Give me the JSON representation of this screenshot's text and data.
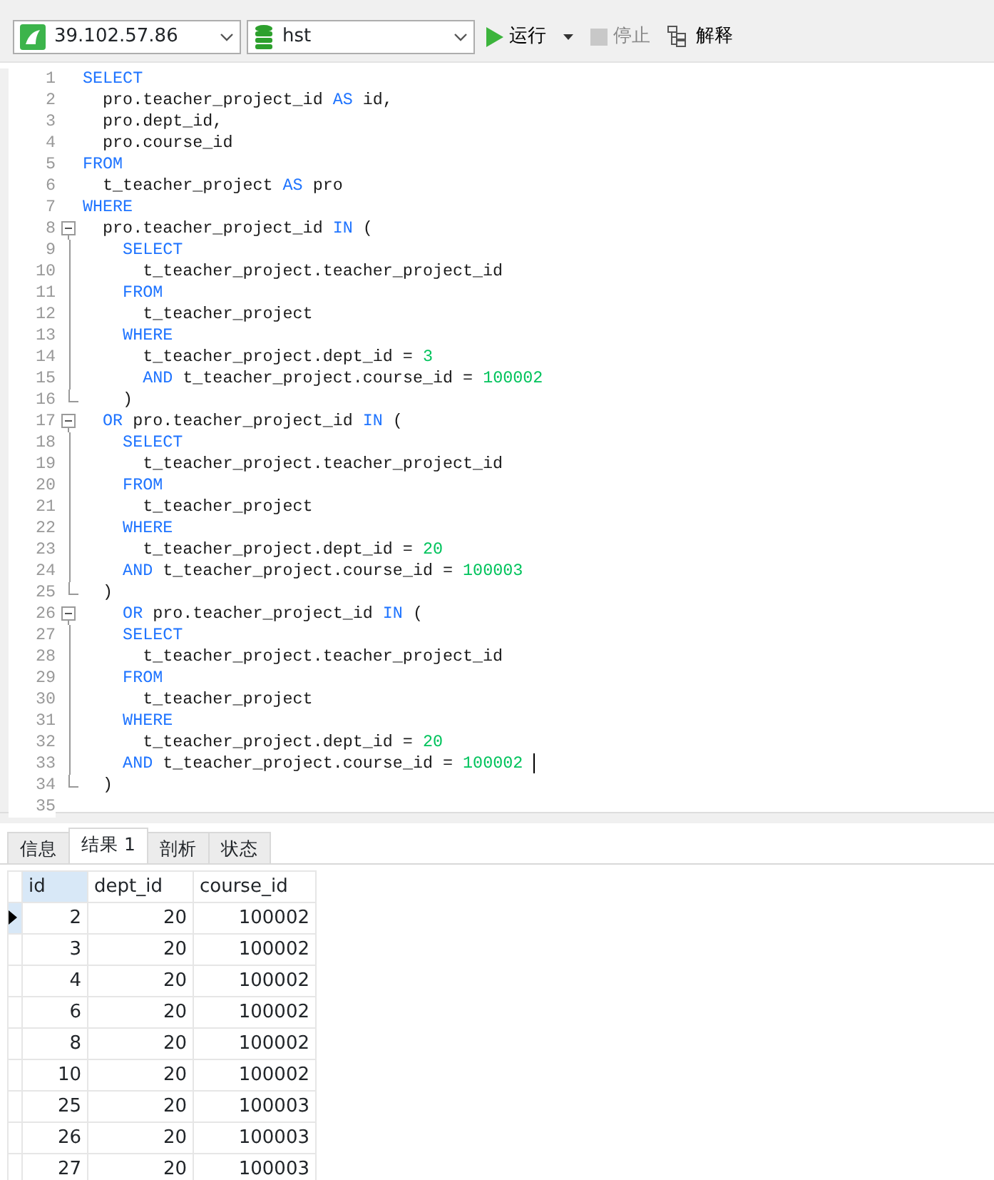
{
  "toolbar": {
    "connection": "39.102.57.86",
    "database": "hst",
    "run": "运行",
    "stop": "停止",
    "explain": "解释"
  },
  "editor": {
    "lines": [
      {
        "num": "1",
        "kind": "plain",
        "tokens": [
          {
            "kind": "keyword",
            "text": "SELECT"
          }
        ]
      },
      {
        "num": "2",
        "kind": "plain",
        "tokens": [
          {
            "kind": "plain",
            "text": "  pro.teacher_project_id "
          },
          {
            "kind": "keyword",
            "text": "AS"
          },
          {
            "kind": "plain",
            "text": " id,"
          }
        ]
      },
      {
        "num": "3",
        "kind": "plain",
        "tokens": [
          {
            "kind": "plain",
            "text": "  pro.dept_id,"
          }
        ]
      },
      {
        "num": "4",
        "kind": "plain",
        "tokens": [
          {
            "kind": "plain",
            "text": "  pro.course_id"
          }
        ]
      },
      {
        "num": "5",
        "kind": "plain",
        "tokens": [
          {
            "kind": "keyword",
            "text": "FROM"
          }
        ]
      },
      {
        "num": "6",
        "kind": "plain",
        "tokens": [
          {
            "kind": "plain",
            "text": "  t_teacher_project "
          },
          {
            "kind": "keyword",
            "text": "AS"
          },
          {
            "kind": "plain",
            "text": " pro"
          }
        ]
      },
      {
        "num": "7",
        "kind": "plain",
        "tokens": [
          {
            "kind": "keyword",
            "text": "WHERE"
          }
        ]
      },
      {
        "num": "8",
        "kind": "foldstart",
        "tokens": [
          {
            "kind": "plain",
            "text": "  pro.teacher_project_id "
          },
          {
            "kind": "keyword",
            "text": "IN"
          },
          {
            "kind": "plain",
            "text": " ("
          }
        ]
      },
      {
        "num": "9",
        "kind": "foldbody",
        "tokens": [
          {
            "kind": "keyword",
            "text": "    SELECT"
          }
        ]
      },
      {
        "num": "10",
        "kind": "foldbody",
        "tokens": [
          {
            "kind": "plain",
            "text": "      t_teacher_project.teacher_project_id"
          }
        ]
      },
      {
        "num": "11",
        "kind": "foldbody",
        "tokens": [
          {
            "kind": "keyword",
            "text": "    FROM"
          }
        ]
      },
      {
        "num": "12",
        "kind": "foldbody",
        "tokens": [
          {
            "kind": "plain",
            "text": "      t_teacher_project"
          }
        ]
      },
      {
        "num": "13",
        "kind": "foldbody",
        "tokens": [
          {
            "kind": "keyword",
            "text": "    WHERE"
          }
        ]
      },
      {
        "num": "14",
        "kind": "foldbody",
        "tokens": [
          {
            "kind": "plain",
            "text": "      t_teacher_project.dept_id = "
          },
          {
            "kind": "number",
            "text": "3"
          }
        ]
      },
      {
        "num": "15",
        "kind": "foldbody",
        "tokens": [
          {
            "kind": "keyword",
            "text": "      AND"
          },
          {
            "kind": "plain",
            "text": " t_teacher_project.course_id = "
          },
          {
            "kind": "number",
            "text": "100002"
          }
        ]
      },
      {
        "num": "16",
        "kind": "foldend",
        "tokens": [
          {
            "kind": "plain",
            "text": "    )"
          }
        ]
      },
      {
        "num": "17",
        "kind": "foldstart",
        "tokens": [
          {
            "kind": "keyword",
            "text": "  OR"
          },
          {
            "kind": "plain",
            "text": " pro.teacher_project_id "
          },
          {
            "kind": "keyword",
            "text": "IN"
          },
          {
            "kind": "plain",
            "text": " ("
          }
        ]
      },
      {
        "num": "18",
        "kind": "foldbody",
        "tokens": [
          {
            "kind": "keyword",
            "text": "    SELECT"
          }
        ]
      },
      {
        "num": "19",
        "kind": "foldbody",
        "tokens": [
          {
            "kind": "plain",
            "text": "      t_teacher_project.teacher_project_id"
          }
        ]
      },
      {
        "num": "20",
        "kind": "foldbody",
        "tokens": [
          {
            "kind": "keyword",
            "text": "    FROM"
          }
        ]
      },
      {
        "num": "21",
        "kind": "foldbody",
        "tokens": [
          {
            "kind": "plain",
            "text": "      t_teacher_project"
          }
        ]
      },
      {
        "num": "22",
        "kind": "foldbody",
        "tokens": [
          {
            "kind": "keyword",
            "text": "    WHERE"
          }
        ]
      },
      {
        "num": "23",
        "kind": "foldbody",
        "tokens": [
          {
            "kind": "plain",
            "text": "      t_teacher_project.dept_id = "
          },
          {
            "kind": "number",
            "text": "20"
          }
        ]
      },
      {
        "num": "24",
        "kind": "foldbody",
        "tokens": [
          {
            "kind": "keyword",
            "text": "    AND"
          },
          {
            "kind": "plain",
            "text": " t_teacher_project.course_id = "
          },
          {
            "kind": "number",
            "text": "100003"
          }
        ]
      },
      {
        "num": "25",
        "kind": "foldend",
        "tokens": [
          {
            "kind": "plain",
            "text": "  )"
          }
        ]
      },
      {
        "num": "26",
        "kind": "foldstart",
        "tokens": [
          {
            "kind": "keyword",
            "text": "    OR"
          },
          {
            "kind": "plain",
            "text": " pro.teacher_project_id "
          },
          {
            "kind": "keyword",
            "text": "IN"
          },
          {
            "kind": "plain",
            "text": " ("
          }
        ]
      },
      {
        "num": "27",
        "kind": "foldbody",
        "tokens": [
          {
            "kind": "keyword",
            "text": "    SELECT"
          }
        ]
      },
      {
        "num": "28",
        "kind": "foldbody",
        "tokens": [
          {
            "kind": "plain",
            "text": "      t_teacher_project.teacher_project_id"
          }
        ]
      },
      {
        "num": "29",
        "kind": "foldbody",
        "tokens": [
          {
            "kind": "keyword",
            "text": "    FROM"
          }
        ]
      },
      {
        "num": "30",
        "kind": "foldbody",
        "tokens": [
          {
            "kind": "plain",
            "text": "      t_teacher_project"
          }
        ]
      },
      {
        "num": "31",
        "kind": "foldbody",
        "tokens": [
          {
            "kind": "keyword",
            "text": "    WHERE"
          }
        ]
      },
      {
        "num": "32",
        "kind": "foldbody",
        "tokens": [
          {
            "kind": "plain",
            "text": "      t_teacher_project.dept_id = "
          },
          {
            "kind": "number",
            "text": "20"
          }
        ]
      },
      {
        "num": "33",
        "kind": "foldbody",
        "cursor": true,
        "tokens": [
          {
            "kind": "keyword",
            "text": "    AND"
          },
          {
            "kind": "plain",
            "text": " t_teacher_project.course_id = "
          },
          {
            "kind": "number",
            "text": "100002"
          }
        ]
      },
      {
        "num": "34",
        "kind": "foldend",
        "tokens": [
          {
            "kind": "plain",
            "text": "  )"
          }
        ]
      },
      {
        "num": "35",
        "kind": "plain"
      }
    ]
  },
  "result_tabs": [
    {
      "label": "信息",
      "selected": false
    },
    {
      "label": "结果 1",
      "selected": true
    },
    {
      "label": "剖析",
      "selected": false
    },
    {
      "label": "状态",
      "selected": false
    }
  ],
  "table": {
    "columns": [
      {
        "label": "id",
        "selected": true
      },
      {
        "label": "dept_id",
        "selected": false
      },
      {
        "label": "course_id",
        "selected": false
      }
    ],
    "rows": [
      {
        "selected": true,
        "cells": [
          "2",
          "20",
          "100002"
        ]
      },
      {
        "selected": false,
        "cells": [
          "3",
          "20",
          "100002"
        ]
      },
      {
        "selected": false,
        "cells": [
          "4",
          "20",
          "100002"
        ]
      },
      {
        "selected": false,
        "cells": [
          "6",
          "20",
          "100002"
        ]
      },
      {
        "selected": false,
        "cells": [
          "8",
          "20",
          "100002"
        ]
      },
      {
        "selected": false,
        "cells": [
          "10",
          "20",
          "100002"
        ]
      },
      {
        "selected": false,
        "cells": [
          "25",
          "20",
          "100003"
        ]
      },
      {
        "selected": false,
        "cells": [
          "26",
          "20",
          "100003"
        ]
      },
      {
        "selected": false,
        "cells": [
          "27",
          "20",
          "100003"
        ]
      }
    ]
  }
}
